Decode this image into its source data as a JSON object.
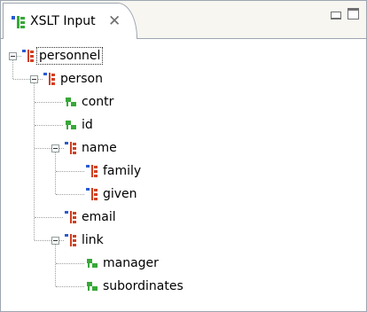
{
  "tab": {
    "title": "XSLT Input",
    "close_glyph": "✕",
    "icon": "xml-tree-icon"
  },
  "view_controls": {
    "minimize_icon": "minimize-icon",
    "maximize_icon": "maximize-icon"
  },
  "tree": {
    "nodes": [
      {
        "id": "personnel",
        "label": "personnel",
        "type": "element",
        "expanded": true,
        "selected": true
      },
      {
        "id": "person",
        "label": "person",
        "type": "element",
        "expanded": true
      },
      {
        "id": "contr",
        "label": "contr",
        "type": "attribute"
      },
      {
        "id": "id",
        "label": "id",
        "type": "attribute"
      },
      {
        "id": "name",
        "label": "name",
        "type": "element",
        "expanded": true
      },
      {
        "id": "family",
        "label": "family",
        "type": "element"
      },
      {
        "id": "given",
        "label": "given",
        "type": "element"
      },
      {
        "id": "email",
        "label": "email",
        "type": "element"
      },
      {
        "id": "link",
        "label": "link",
        "type": "element",
        "expanded": true
      },
      {
        "id": "manager",
        "label": "manager",
        "type": "attribute"
      },
      {
        "id": "subordinates",
        "label": "subordinates",
        "type": "attribute"
      }
    ]
  },
  "colors": {
    "element_icon": "#d04020",
    "element_icon_accent": "#2a5ad0",
    "attribute_icon": "#38a838",
    "tree_lines": "#a0a0a0",
    "border": "#9da6b0"
  }
}
